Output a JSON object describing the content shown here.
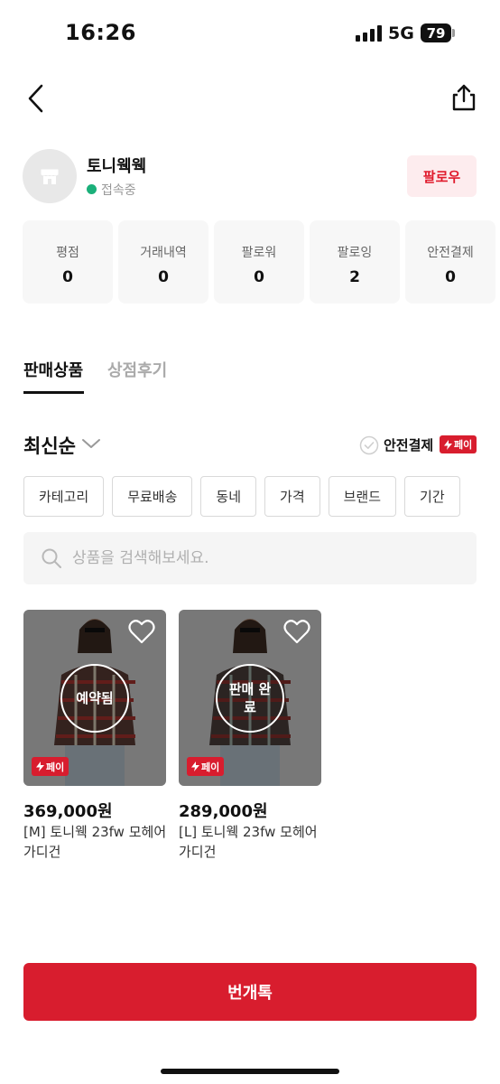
{
  "status_bar": {
    "time": "16:26",
    "network": "5G",
    "battery": "79"
  },
  "header": {
    "back_icon": "chevron-left-icon",
    "share_icon": "share-icon"
  },
  "profile": {
    "name": "토니웩웩",
    "status": "접속중",
    "follow_label": "팔로우"
  },
  "stats": [
    {
      "label": "평점",
      "value": "0"
    },
    {
      "label": "거래내역",
      "value": "0"
    },
    {
      "label": "팔로워",
      "value": "0"
    },
    {
      "label": "팔로잉",
      "value": "2"
    },
    {
      "label": "안전결제",
      "value": "0"
    }
  ],
  "tabs": [
    {
      "label": "판매상품",
      "active": true
    },
    {
      "label": "상점후기",
      "active": false
    }
  ],
  "sort": {
    "label": "최신순"
  },
  "safe_pay": {
    "label": "안전결제",
    "badge": "페이"
  },
  "chips": [
    "카테고리",
    "무료배송",
    "동네",
    "가격",
    "브랜드",
    "기간"
  ],
  "search": {
    "placeholder": "상품을 검색해보세요."
  },
  "products": [
    {
      "status": "예약됨",
      "pay_badge": "페이",
      "price": "369,000원",
      "name": "[M] 토니웩 23fw 모헤어 가디건"
    },
    {
      "status": "판매 완료",
      "pay_badge": "페이",
      "price": "289,000원",
      "name": "[L] 토니웩 23fw 모헤어 가디건"
    }
  ],
  "chat_button": "번개톡",
  "colors": {
    "brand_red": "#d81d2e",
    "online_green": "#1bb07a",
    "follow_bg": "#fdecee"
  }
}
